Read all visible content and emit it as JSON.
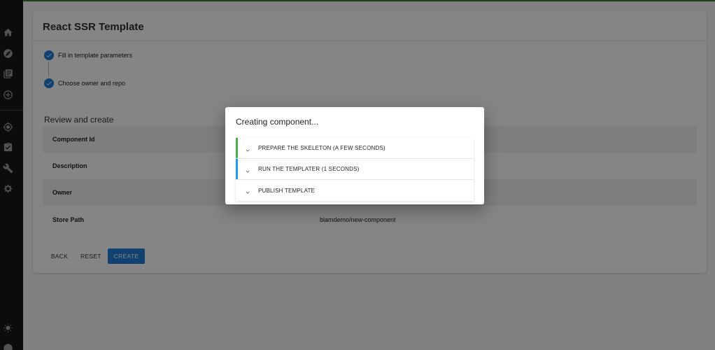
{
  "sidebar": {
    "icons": [
      "home-icon",
      "compass-icon",
      "library-icon",
      "add-circle-icon",
      "location-icon",
      "checklist-icon",
      "wrench-icon",
      "puzzle-icon",
      "sun-icon",
      "user-icon"
    ]
  },
  "colors": {
    "accent": "#1f7ed6",
    "success": "#4caf50",
    "running": "#2196f3",
    "topline": "#2e7d32"
  },
  "card": {
    "title": "React SSR Template",
    "steps": [
      {
        "label": "Fill in template parameters",
        "status": "complete"
      },
      {
        "label": "Choose owner and repo",
        "status": "complete"
      }
    ],
    "review_title": "Review and create",
    "review_rows": [
      {
        "key": "Component Id",
        "value": ""
      },
      {
        "key": "Description",
        "value": ""
      },
      {
        "key": "Owner",
        "value": ""
      },
      {
        "key": "Store Path",
        "value": "blamdemo/new-component"
      }
    ],
    "buttons": {
      "back": "BACK",
      "reset": "RESET",
      "create": "CREATE"
    }
  },
  "dialog": {
    "title": "Creating component...",
    "tasks": [
      {
        "label": "PREPARE THE SKELETON (A FEW SECONDS)",
        "status": "success"
      },
      {
        "label": "RUN THE TEMPLATER (1 SECONDS)",
        "status": "running"
      },
      {
        "label": "PUBLISH TEMPLATE",
        "status": "pending"
      }
    ]
  }
}
